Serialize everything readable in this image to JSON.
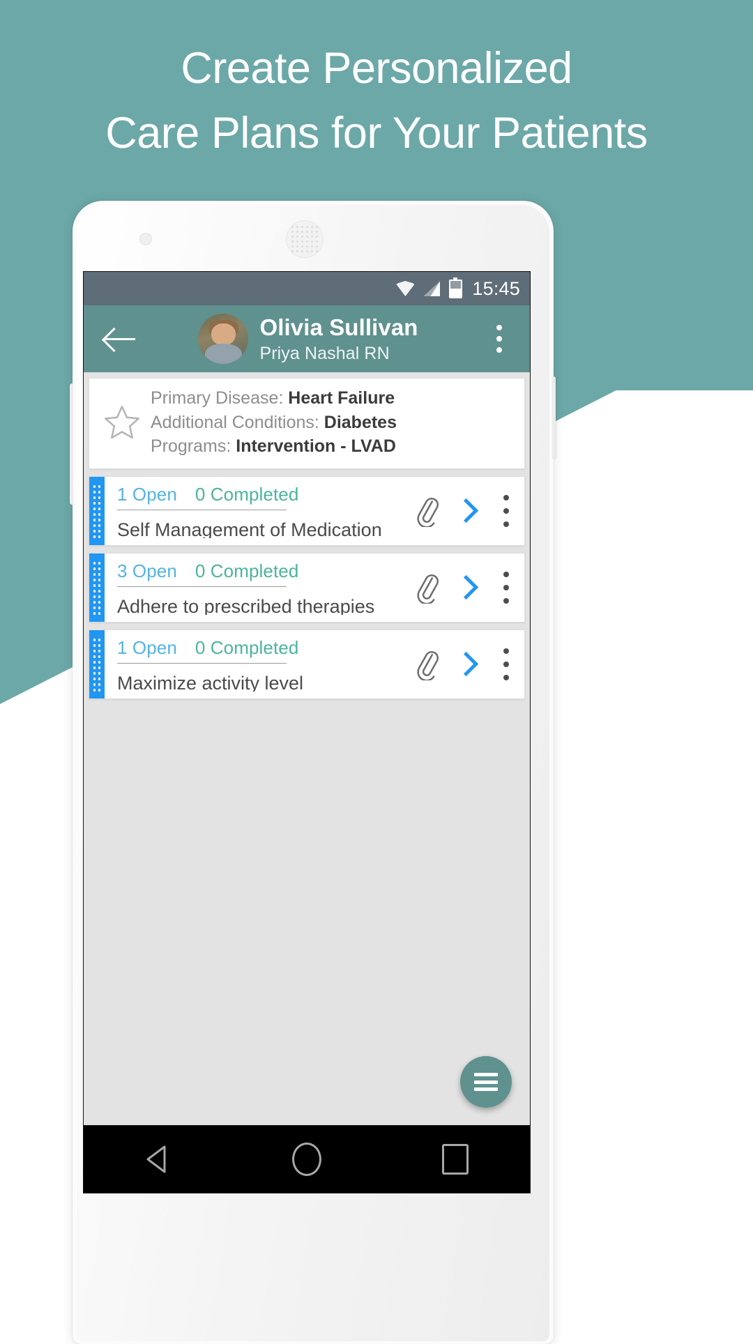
{
  "promo": {
    "headline_line1": "Create Personalized",
    "headline_line2": "Care Plans for Your Patients",
    "background_color": "#6ca8a8"
  },
  "statusbar": {
    "time": "15:45",
    "icons": [
      "wifi-icon",
      "signal-icon",
      "battery-icon"
    ],
    "background_color": "#5f6d78"
  },
  "appbar": {
    "back_icon": "back-arrow-icon",
    "patient_name": "Olivia Sullivan",
    "nurse_name": "Priya Nashal RN",
    "overflow_icon": "overflow-menu-icon",
    "avatar": "patient-avatar",
    "background_color": "#5f918f"
  },
  "info_card": {
    "star_icon": "star-outline-icon",
    "rows": [
      {
        "label": "Primary Disease: ",
        "value": "Heart Failure"
      },
      {
        "label": "Additional Conditions: ",
        "value": "Diabetes"
      },
      {
        "label": "Programs: ",
        "value": "Intervention - LVAD"
      }
    ]
  },
  "goals": [
    {
      "open": "1 Open",
      "completed": "0  Completed",
      "title": "Self Management of Medication",
      "attachment_icon": "paperclip-icon",
      "chevron_icon": "chevron-right-icon",
      "overflow_icon": "overflow-menu-icon",
      "handle_icon": "drag-handle-icon"
    },
    {
      "open": "3 Open",
      "completed": "0  Completed",
      "title": "Adhere to prescribed therapies",
      "attachment_icon": "paperclip-icon",
      "chevron_icon": "chevron-right-icon",
      "overflow_icon": "overflow-menu-icon",
      "handle_icon": "drag-handle-icon"
    },
    {
      "open": "1 Open",
      "completed": "0  Completed",
      "title": "Maximize activity level",
      "attachment_icon": "paperclip-icon",
      "chevron_icon": "chevron-right-icon",
      "overflow_icon": "overflow-menu-icon",
      "handle_icon": "drag-handle-icon"
    }
  ],
  "fab": {
    "icon": "list-menu-icon",
    "color": "#5f918f"
  },
  "navbar": {
    "back_icon": "android-back-icon",
    "home_icon": "android-home-icon",
    "recents_icon": "android-recents-icon"
  },
  "colors": {
    "open_text": "#54b3e4",
    "completed_text": "#4bb49c",
    "accent_blue": "#2196f3",
    "content_background": "#e3e3e3"
  }
}
